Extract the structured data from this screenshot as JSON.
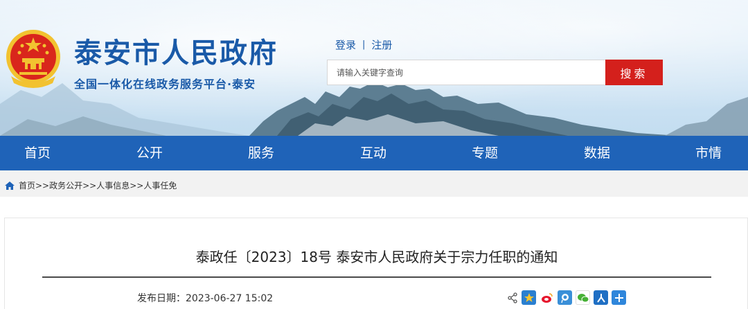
{
  "header": {
    "title": "泰安市人民政府",
    "subtitle": "全国一体化在线政务服务平台·泰安",
    "login_label": "登录",
    "separator": "|",
    "register_label": "注册",
    "search_placeholder": "请输入关键字查询",
    "search_value": "",
    "search_button": "搜索"
  },
  "nav": {
    "items": [
      "首页",
      "公开",
      "服务",
      "互动",
      "专题",
      "数据",
      "市情"
    ]
  },
  "breadcrumb": {
    "text": "首页>>政务公开>>人事信息>>人事任免"
  },
  "article": {
    "title": "泰政任〔2023〕18号 泰安市人民政府关于宗力任职的通知",
    "date_label": "发布日期：2023-06-27 15:02"
  },
  "share": {
    "icons": [
      "share-icon",
      "qzone-icon",
      "weibo-icon",
      "tencent-weibo-icon",
      "wechat-icon",
      "renren-icon",
      "more-icon"
    ]
  },
  "colors": {
    "brand_blue": "#1f63b8",
    "title_blue": "#1a5aa8",
    "search_red": "#d4201c"
  }
}
